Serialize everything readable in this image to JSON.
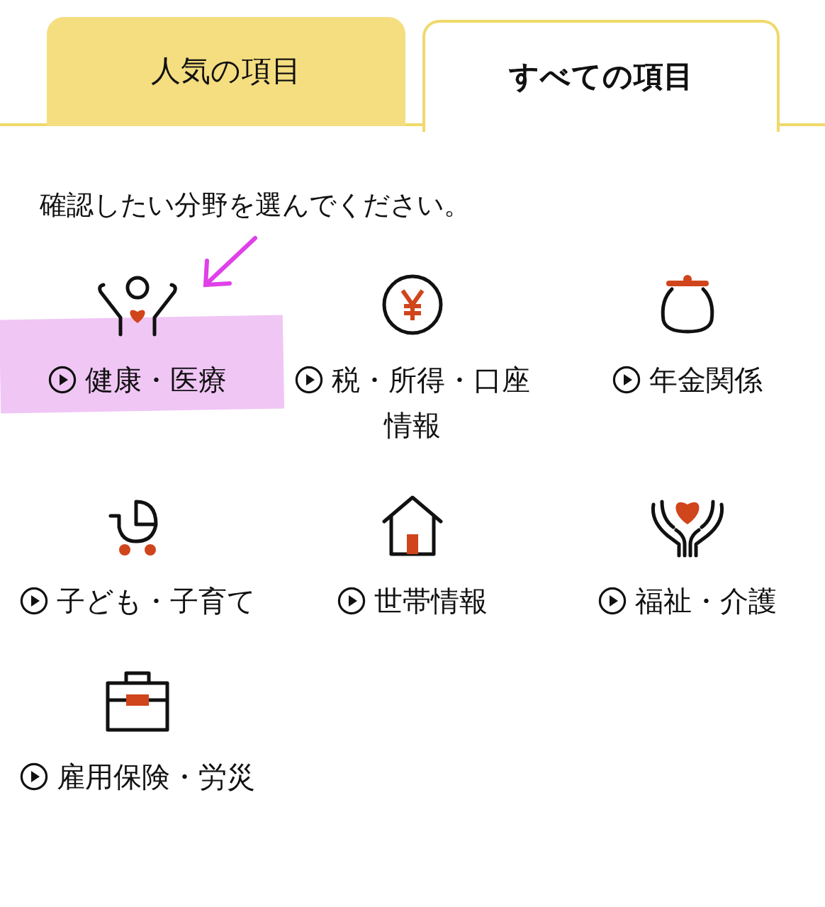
{
  "tabs": [
    {
      "label": "人気の項目",
      "selected": false
    },
    {
      "label": "すべての項目",
      "selected": true
    }
  ],
  "instruction": "確認したい分野を選んでください。",
  "categories": [
    {
      "kind": "health",
      "label": "健康・医療",
      "highlighted": true
    },
    {
      "kind": "tax",
      "label": "税・所得・口座情報",
      "highlighted": false
    },
    {
      "kind": "pension",
      "label": "年金関係",
      "highlighted": false
    },
    {
      "kind": "child",
      "label": "子ども・子育て",
      "highlighted": false
    },
    {
      "kind": "household",
      "label": "世帯情報",
      "highlighted": false
    },
    {
      "kind": "welfare",
      "label": "福祉・介護",
      "highlighted": false
    },
    {
      "kind": "employment",
      "label": "雇用保険・労災",
      "highlighted": false
    }
  ]
}
